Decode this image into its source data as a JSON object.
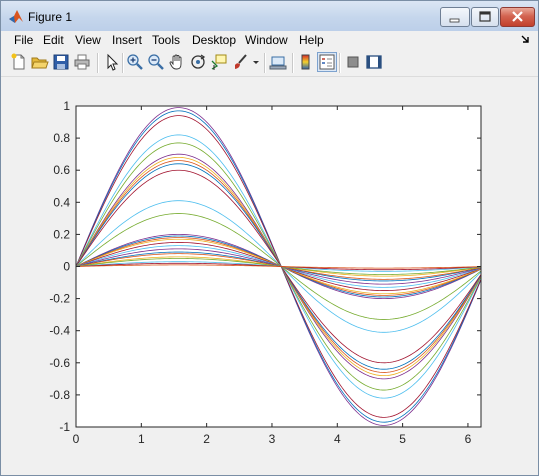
{
  "window": {
    "title": "Figure 1",
    "icon": "matlab-logo-icon",
    "controls": [
      "minimize-icon",
      "maximize-icon",
      "close-icon"
    ]
  },
  "menubar": {
    "items": [
      "File",
      "Edit",
      "View",
      "Insert",
      "Tools",
      "Desktop",
      "Window",
      "Help"
    ]
  },
  "toolbar": {
    "buttons": [
      "new-figure-icon",
      "open-file-icon",
      "save-figure-icon",
      "print-figure-icon",
      "edit-plot-arrow-icon",
      "zoom-in-icon",
      "zoom-out-icon",
      "pan-hand-icon",
      "rotate-3d-icon",
      "data-cursor-icon",
      "brush-icon",
      "brush-dropdown-icon",
      "link-plot-icon",
      "insert-colorbar-icon",
      "insert-legend-icon",
      "hide-plot-tools-icon",
      "show-plot-tools-icon"
    ]
  },
  "chart_data": {
    "type": "line",
    "title": "",
    "xlabel": "",
    "ylabel": "",
    "function": "y = a*sin(x)",
    "x_range": [
      0,
      6.2
    ],
    "xlim": [
      0,
      6.2
    ],
    "ylim": [
      -1,
      1
    ],
    "xticks": [
      "0",
      "1",
      "2",
      "3",
      "4",
      "5",
      "6"
    ],
    "yticks": [
      "1",
      "0.8",
      "0.6",
      "0.4",
      "0.2",
      "0",
      "-0.2",
      "-0.4",
      "-0.6",
      "-0.8",
      "-1"
    ],
    "grid": false,
    "legend": "none",
    "series": [
      {
        "amplitude": 0.99,
        "color": "#7E2F8E"
      },
      {
        "amplitude": 0.97,
        "color": "#0072BD"
      },
      {
        "amplitude": 0.94,
        "color": "#A2142F"
      },
      {
        "amplitude": 0.82,
        "color": "#4DBEEE"
      },
      {
        "amplitude": 0.77,
        "color": "#77AC30"
      },
      {
        "amplitude": 0.7,
        "color": "#7E2F8E"
      },
      {
        "amplitude": 0.68,
        "color": "#EDB120"
      },
      {
        "amplitude": 0.66,
        "color": "#D95319"
      },
      {
        "amplitude": 0.64,
        "color": "#0072BD"
      },
      {
        "amplitude": 0.6,
        "color": "#A2142F"
      },
      {
        "amplitude": 0.41,
        "color": "#4DBEEE"
      },
      {
        "amplitude": 0.33,
        "color": "#77AC30"
      },
      {
        "amplitude": 0.2,
        "color": "#7E2F8E"
      },
      {
        "amplitude": 0.19,
        "color": "#0072BD"
      },
      {
        "amplitude": 0.18,
        "color": "#D95319"
      },
      {
        "amplitude": 0.17,
        "color": "#EDB120"
      },
      {
        "amplitude": 0.15,
        "color": "#A2142F"
      },
      {
        "amplitude": 0.13,
        "color": "#4DBEEE"
      },
      {
        "amplitude": 0.11,
        "color": "#7E2F8E"
      },
      {
        "amplitude": 0.09,
        "color": "#0072BD"
      },
      {
        "amplitude": 0.08,
        "color": "#D95319"
      },
      {
        "amplitude": 0.06,
        "color": "#EDB120"
      },
      {
        "amplitude": 0.05,
        "color": "#77AC30"
      },
      {
        "amplitude": 0.03,
        "color": "#4DBEEE"
      },
      {
        "amplitude": 0.02,
        "color": "#A2142F"
      },
      {
        "amplitude": 0.01,
        "color": "#D95319"
      }
    ]
  }
}
